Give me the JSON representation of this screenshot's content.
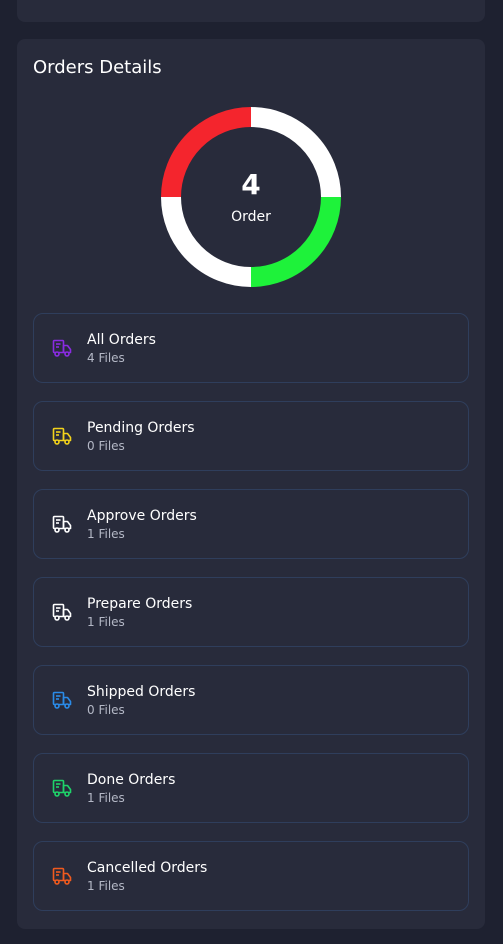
{
  "panel": {
    "title": "Orders Details"
  },
  "donut": {
    "count": "4",
    "label": "Order",
    "segments": [
      {
        "name": "Approve Orders",
        "value": 1,
        "color": "#ffffff"
      },
      {
        "name": "Done Orders",
        "value": 1,
        "color": "#1ef23a"
      },
      {
        "name": "Prepare Orders",
        "value": 1,
        "color": "#ffffff"
      },
      {
        "name": "Cancelled Orders",
        "value": 1,
        "color": "#f4252d"
      }
    ]
  },
  "orders": [
    {
      "name": "All Orders",
      "files": "4 Files",
      "icon": "truck-icon",
      "color": "#8a2be2"
    },
    {
      "name": "Pending Orders",
      "files": "0 Files",
      "icon": "truck-icon",
      "color": "#f2d21b"
    },
    {
      "name": "Approve Orders",
      "files": "1 Files",
      "icon": "truck-icon",
      "color": "#ffffff"
    },
    {
      "name": "Prepare Orders",
      "files": "1 Files",
      "icon": "truck-icon",
      "color": "#ffffff"
    },
    {
      "name": "Shipped Orders",
      "files": "0 Files",
      "icon": "truck-icon",
      "color": "#2a8be8"
    },
    {
      "name": "Done Orders",
      "files": "1 Files",
      "icon": "truck-icon",
      "color": "#1ed46a"
    },
    {
      "name": "Cancelled Orders",
      "files": "1 Files",
      "icon": "truck-icon",
      "color": "#f05a1e"
    }
  ]
}
